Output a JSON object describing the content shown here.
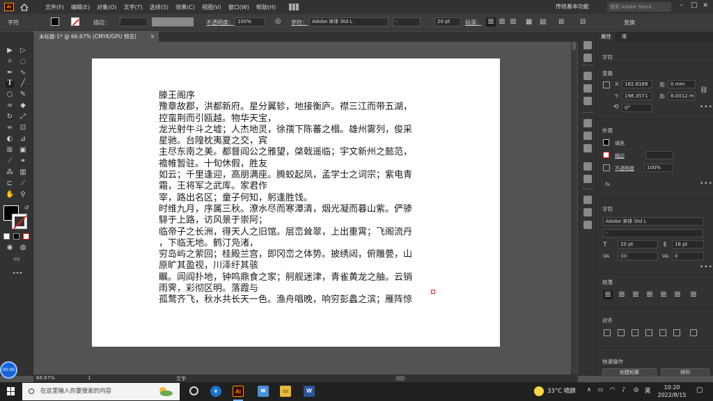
{
  "menubar": {
    "logo": "Ai",
    "items": [
      "文件(F)",
      "编辑(E)",
      "对象(O)",
      "文字(T)",
      "选择(S)",
      "效果(C)",
      "视图(V)",
      "窗口(W)",
      "帮助(H)"
    ],
    "workspace": "传统基本功能",
    "stock_search_placeholder": "搜索 Adobe Stock"
  },
  "controlbar": {
    "label_text": "字符",
    "stroke_label": "描边：",
    "opacity_label": "不透明度：",
    "opacity_value": "100%",
    "char_label": "字符：",
    "font_name": "Adobe 宋体 Std L",
    "font_style": "-",
    "font_size": "20 pt",
    "paragraph_label": "段落：",
    "transform_label": "变换"
  },
  "tab": {
    "title": "未标题-1* @ 66.67% (CMYK/GPU 预览)",
    "close": "×"
  },
  "poem": {
    "lines": [
      "滕王阁序",
      "豫章故郡，洪都新府。星分翼轸，地接衡庐。襟三江而带五湖，",
      "控蛮荆而引瓯越。物华天宝，",
      "龙光射牛斗之墟；人杰地灵，徐孺下陈蕃之榻。雄州雾列，俊采",
      "星驰。台隍枕夷夏之交，宾",
      "主尽东南之美。都督阎公之雅望，棨戟遥临；宇文新州之懿范，",
      "襜帷暂驻。十旬休假，胜友",
      "如云；千里逢迎，高朋满座。腾蛟起凤，孟学士之词宗；紫电青",
      "霜，王将军之武库。家君作",
      "宰，路出名区；童子何知，躬逢胜饯。",
      "时维九月，序属三秋。潦水尽而寒潭清，烟光凝而暮山紫。俨骖",
      "騑于上路，访风景于崇阿；",
      "临帝子之长洲，得天人之旧馆。层峦耸翠，上出重霄；飞阁流丹",
      "，下临无地。鹤汀凫渚，",
      "穷岛屿之萦回；桂殿兰宫，即冈峦之体势。披绣闼，俯雕甍，山",
      "原旷其盈视，川泽纡其骇",
      "瞩。闾阎扑地，钟鸣鼎食之家；舸舰迷津，青雀黄龙之舳。云销",
      "雨霁，彩彻区明。落霞与",
      "孤鹜齐飞，秋水共长天一色。渔舟唱晚，响穷彭蠡之滨；雁阵惊"
    ]
  },
  "statusbar": {
    "zoom": "66.67%",
    "page": "1",
    "tool": "文字"
  },
  "props": {
    "tab_properties": "属性",
    "tab_layers": "库",
    "section_char": "字符",
    "section_transform": "变换",
    "x_label": "X:",
    "x_value": "182.8189",
    "y_label": "Y:",
    "y_value": "198.3571",
    "w_label": "宽:",
    "w_value": "0 mm",
    "h_label": "高:",
    "h_value": "8.0012 m",
    "angle_value": "0°",
    "section_appearance": "外观",
    "fill_label": "填色",
    "stroke_label": "描边",
    "opacity_label": "不透明度",
    "opacity_value": "100%",
    "fx_label": "fx.",
    "section_character": "字符",
    "font_name": "Adobe 宋体 Std L",
    "font_style": "-",
    "font_size": "20 pt",
    "leading": "18 pt",
    "tracking_auto": "(0)",
    "tracking": "0",
    "section_paragraph": "段落",
    "section_align": "对齐",
    "section_quick": "快速操作",
    "btn_outline": "创建轮廓",
    "btn_arrange": "排列"
  },
  "taskbar": {
    "search_placeholder": "在这里输入你要搜索的内容",
    "weather": "33°C 晴朗",
    "ime": "英",
    "time": "10:20",
    "date": "2022/8/15",
    "ai_label": "Ai",
    "word_label": "W"
  },
  "recorder": {
    "time": "00:00"
  }
}
